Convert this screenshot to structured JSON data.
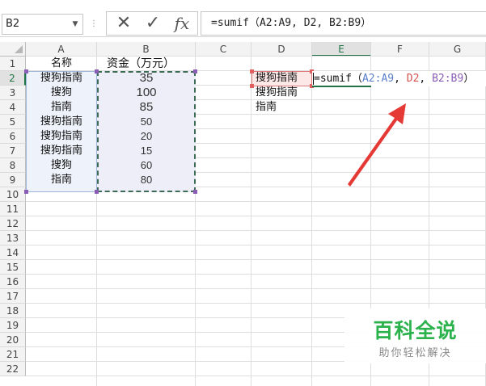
{
  "name_box": {
    "value": "B2"
  },
  "formula_bar": {
    "cancel_glyph": "✕",
    "enter_glyph": "✓",
    "fx_label": "fx",
    "formula": "=sumif（A2:A9, D2, B2:B9）"
  },
  "columns": [
    "A",
    "B",
    "C",
    "D",
    "E",
    "F",
    "G"
  ],
  "rows": [
    "1",
    "2",
    "3",
    "4",
    "5",
    "6",
    "7",
    "8",
    "9",
    "10",
    "11",
    "12",
    "13",
    "14",
    "15",
    "16",
    "17",
    "18",
    "19",
    "20",
    "21",
    "22"
  ],
  "active_column": "E",
  "active_row": "2",
  "cells": {
    "A1": "名称",
    "B1": "资金（万元）",
    "A2": "搜狗指南",
    "B2": "35",
    "A3": "搜狗",
    "B3": "100",
    "A4": "指南",
    "B4": "85",
    "A5": "搜狗指南",
    "B5": "50",
    "A6": "搜狗指南",
    "B6": "20",
    "A7": "搜狗指南",
    "B7": "15",
    "A8": "搜狗",
    "B8": "60",
    "A9": "指南",
    "B9": "80",
    "D2": "搜狗指南",
    "D3": "搜狗指南",
    "D4": "指南"
  },
  "in_cell_formula": {
    "prefix": "=sumif（",
    "arg1": "A2:A9",
    "sep1": ", ",
    "arg2": "D2",
    "sep2": ", ",
    "arg3": "B2:B9",
    "suffix": "）",
    "colors": {
      "arg1": "#5b7fc9",
      "arg2": "#d9534f",
      "arg3": "#8a5db5",
      "arrow": "#e53935"
    }
  },
  "watermark": {
    "title": "百科全说",
    "subtitle": "助你轻松解决"
  }
}
